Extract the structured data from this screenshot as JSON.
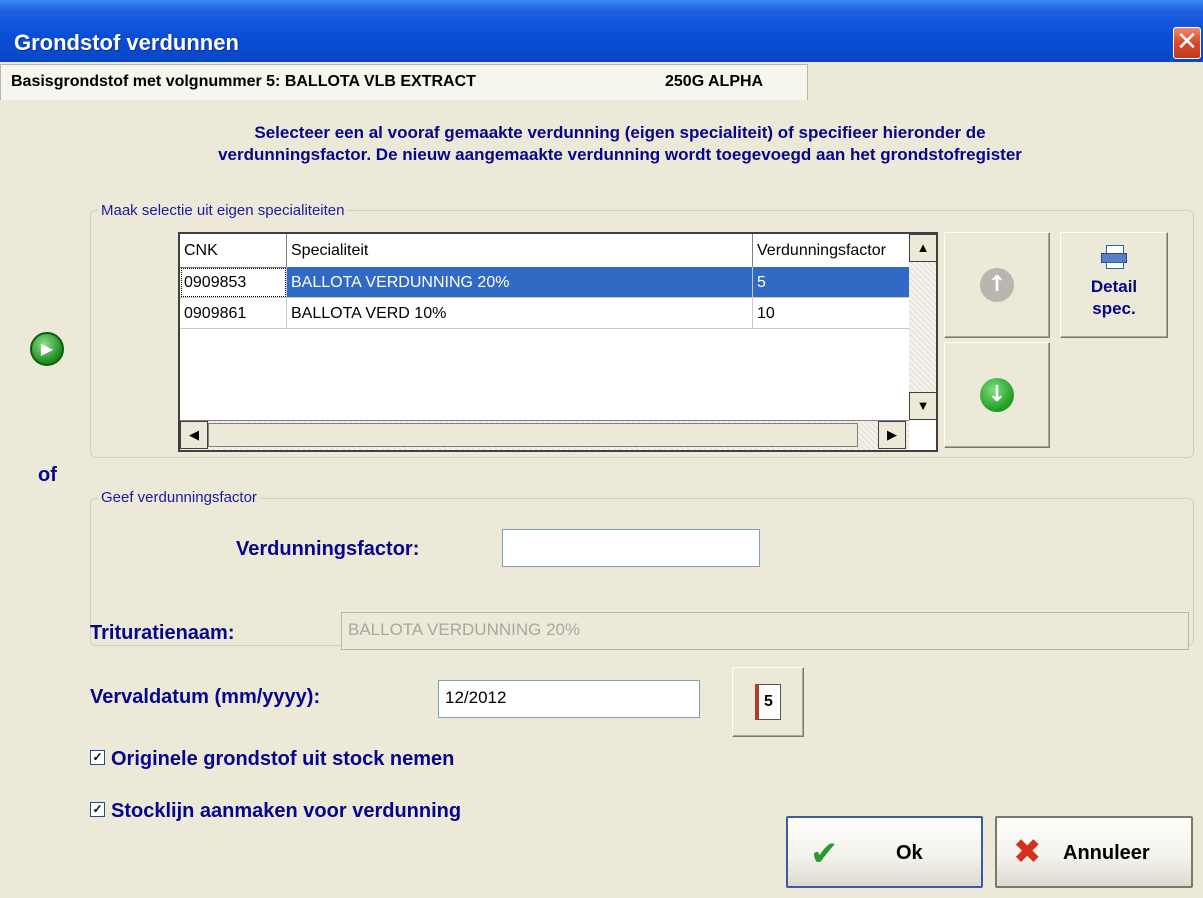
{
  "window": {
    "title": "Grondstof verdunnen",
    "close_glyph": "✕"
  },
  "header": {
    "basis_label": "Basisgrondstof met volgnummer 5: BALLOTA VLB EXTRACT",
    "basis_size": "250G ALPHA"
  },
  "instructions": {
    "line1": "Selecteer een al vooraf gemaakte verdunning (eigen specialiteit) of specifieer hieronder de",
    "line2": "verdunningsfactor. De nieuw aangemaakte verdunning wordt toegevoegd aan het grondstofregister"
  },
  "selection_group": {
    "legend": "Maak selectie uit eigen specialiteiten",
    "columns": [
      "CNK",
      "Specialiteit",
      "Verdunningsfactor"
    ],
    "rows": [
      {
        "cnk": "0909853",
        "name": "BALLOTA VERDUNNING 20%",
        "factor": "5",
        "selected": true
      },
      {
        "cnk": "0909861",
        "name": "BALLOTA VERD 10%",
        "factor": "10",
        "selected": false
      }
    ],
    "detail_button": {
      "line1": "Detail",
      "line2": "spec.",
      "icon": "printer-icon"
    },
    "up_button_icon": "arrow-up-icon",
    "down_button_icon": "arrow-down-icon",
    "radio_icon": "play-circle-icon"
  },
  "or_label": "of",
  "factor_group": {
    "legend": "Geef verdunningsfactor",
    "label": "Verdunningsfactor:",
    "value": ""
  },
  "trituratie": {
    "label": "Trituratienaam:",
    "value": "BALLOTA VERDUNNING 20%"
  },
  "vervaldatum": {
    "label": "Vervaldatum (mm/yyyy):",
    "value": "12/2012",
    "calendar_icon": "calendar-icon",
    "calendar_day": "5"
  },
  "checkboxes": [
    {
      "label": "Originele grondstof uit stock nemen",
      "checked": true
    },
    {
      "label": "Stocklijn aanmaken voor verdunning",
      "checked": true
    }
  ],
  "buttons": {
    "ok_label": "Ok",
    "cancel_label": "Annuleer"
  },
  "colors": {
    "title_bar": "#0a4fd8",
    "selection": "#316ac5",
    "label_text": "#06068a"
  }
}
